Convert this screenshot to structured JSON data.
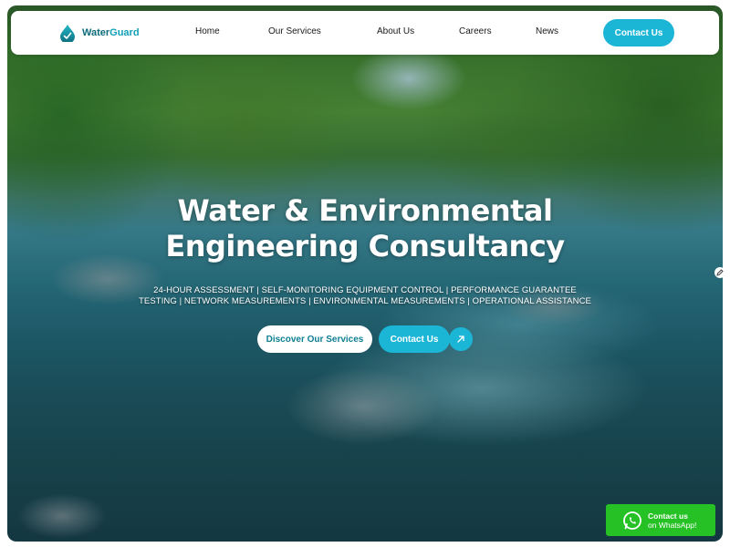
{
  "brand": {
    "name_part1": "Water",
    "name_part2": "Guard",
    "logo_icon": "water-drop-check-icon",
    "primary_color": "#0e6b7a",
    "accent_color": "#1bb6d6"
  },
  "nav": {
    "links": [
      "Home",
      "Our Services",
      "About Us",
      "Careers",
      "News"
    ],
    "contact_label": "Contact Us"
  },
  "hero": {
    "title_line1": "Water & Environmental",
    "title_line2": "Engineering Consultancy",
    "subtitle_line1": "24-HOUR ASSESSMENT | SELF-MONITORING EQUIPMENT CONTROL | PERFORMANCE GUARANTEE",
    "subtitle_line2": "TESTING | NETWORK MEASUREMENTS | ENVIRONMENTAL MEASUREMENTS | OPERATIONAL ASSISTANCE",
    "discover_label": "Discover Our Services",
    "contact_label": "Contact Us",
    "arrow_icon": "arrow-up-right-icon",
    "background": "river-forest-photo"
  },
  "whatsapp": {
    "line1": "Contact us",
    "line2": "on WhatsApp!",
    "icon": "whatsapp-icon",
    "color": "#25c125"
  }
}
